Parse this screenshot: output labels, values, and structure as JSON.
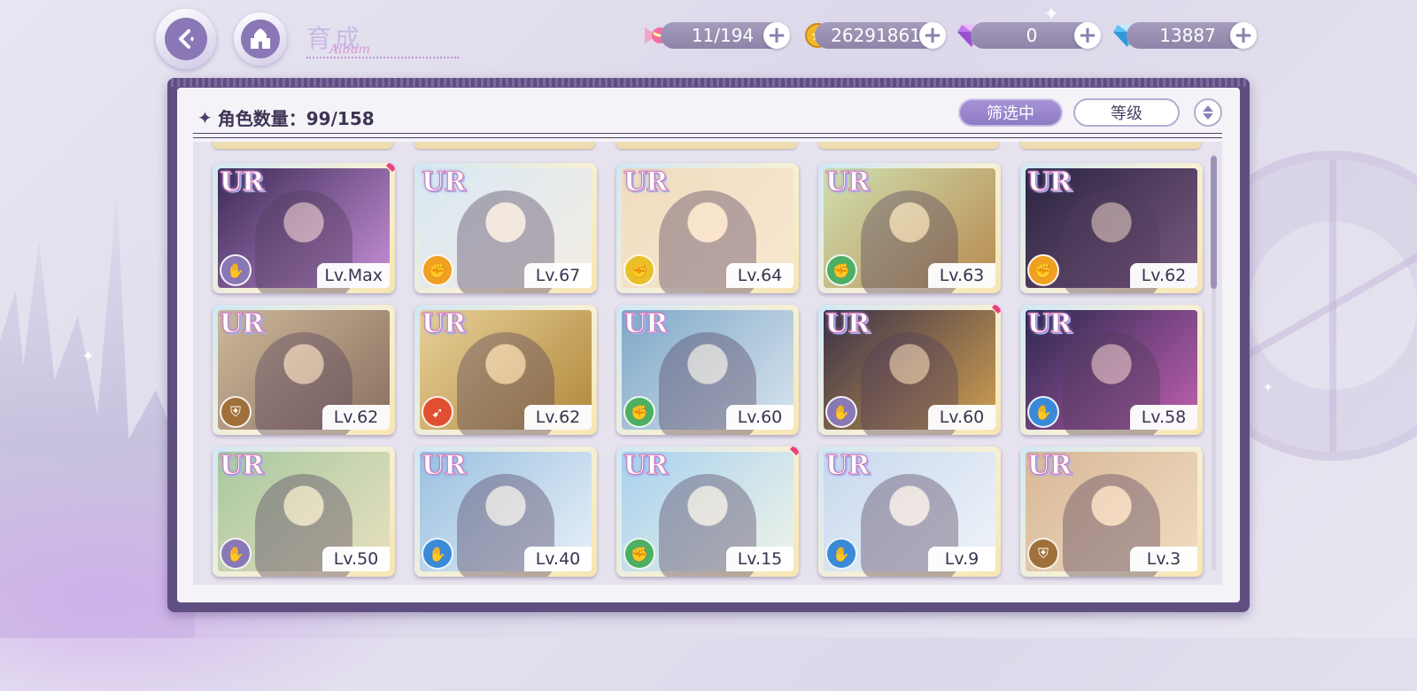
{
  "header": {
    "title": "育成",
    "subtitle_script": "Album",
    "resources": [
      {
        "icon": "candy-icon",
        "value": "11/194"
      },
      {
        "icon": "gold-coin-icon",
        "value": "26291861"
      },
      {
        "icon": "pink-diamond-icon",
        "value": "0"
      },
      {
        "icon": "blue-diamond-icon",
        "value": "13887"
      }
    ]
  },
  "toolbar": {
    "count_label": "角色数量：99/158",
    "filter_label": "筛选中",
    "sort_label": "等级"
  },
  "colors": {
    "purple": "#8a78b6",
    "green": "#4caf64",
    "yellow": "#e8c12a",
    "orange": "#f0a020",
    "brown": "#a0703a",
    "red": "#e05030",
    "blue": "#3a8ad8"
  },
  "cards": [
    {
      "rarity": "UR",
      "level": "Lv.Max",
      "attr": "purple",
      "marked": true
    },
    {
      "rarity": "UR",
      "level": "Lv.67",
      "attr": "orange",
      "marked": false
    },
    {
      "rarity": "UR",
      "level": "Lv.64",
      "attr": "yellow",
      "marked": false
    },
    {
      "rarity": "UR",
      "level": "Lv.63",
      "attr": "green",
      "marked": false
    },
    {
      "rarity": "UR",
      "level": "Lv.62",
      "attr": "orange",
      "marked": false
    },
    {
      "rarity": "UR",
      "level": "Lv.62",
      "attr": "brown",
      "marked": false
    },
    {
      "rarity": "UR",
      "level": "Lv.62",
      "attr": "red",
      "marked": false
    },
    {
      "rarity": "UR",
      "level": "Lv.60",
      "attr": "green",
      "marked": false
    },
    {
      "rarity": "UR",
      "level": "Lv.60",
      "attr": "purple",
      "marked": true
    },
    {
      "rarity": "UR",
      "level": "Lv.58",
      "attr": "blue",
      "marked": false
    },
    {
      "rarity": "UR",
      "level": "Lv.50",
      "attr": "purple",
      "marked": false
    },
    {
      "rarity": "UR",
      "level": "Lv.40",
      "attr": "blue",
      "marked": false
    },
    {
      "rarity": "UR",
      "level": "Lv.15",
      "attr": "green",
      "marked": true
    },
    {
      "rarity": "UR",
      "level": "Lv.9",
      "attr": "blue",
      "marked": false
    },
    {
      "rarity": "UR",
      "level": "Lv.3",
      "attr": "brown",
      "marked": false
    }
  ]
}
